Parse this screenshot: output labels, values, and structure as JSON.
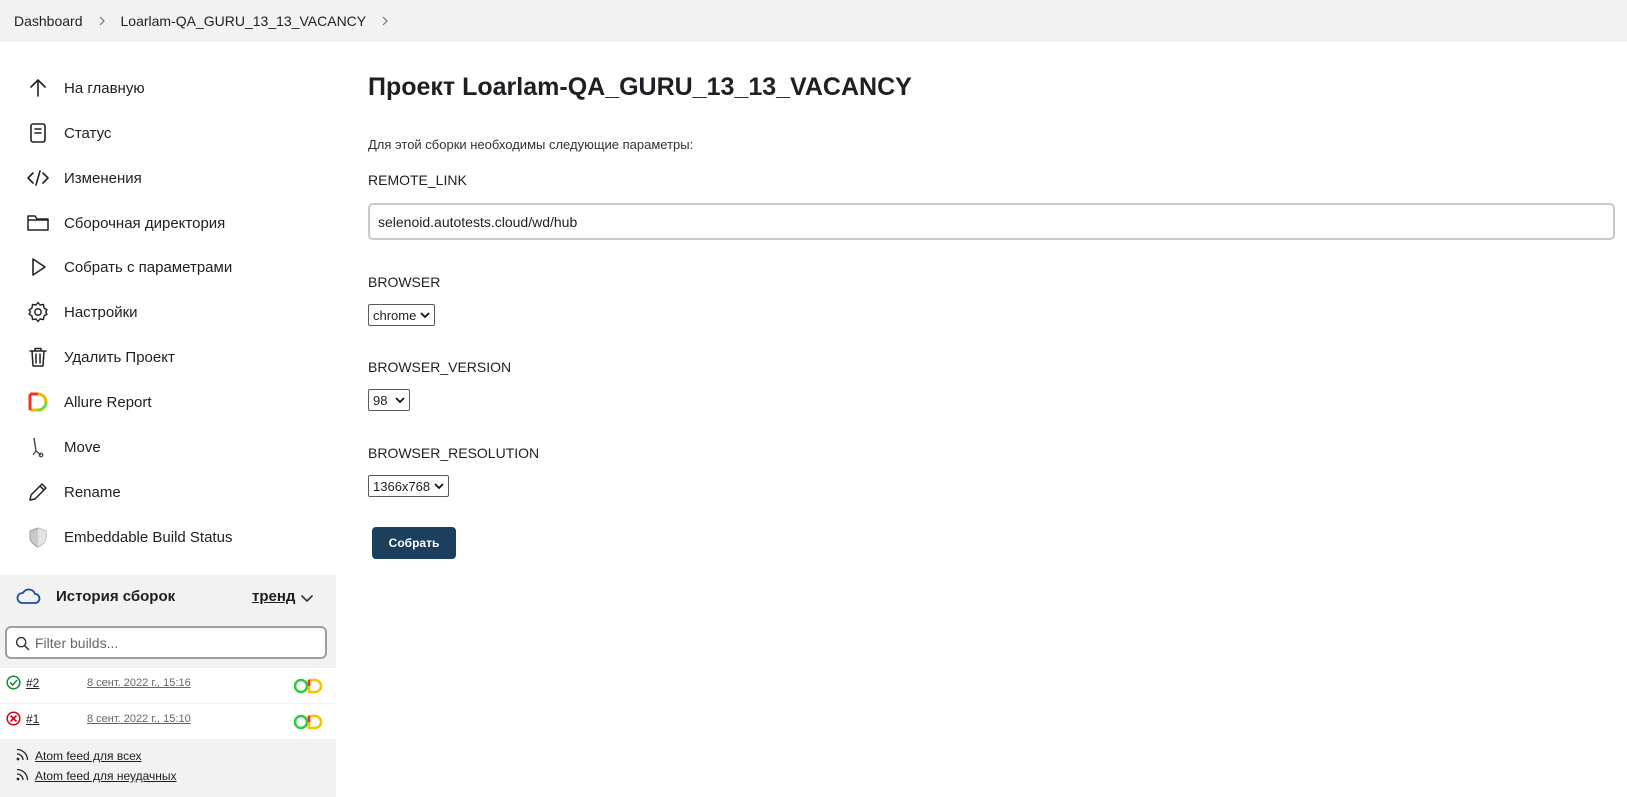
{
  "breadcrumb": {
    "items": [
      "Dashboard",
      "Loarlam-QA_GURU_13_13_VACANCY"
    ]
  },
  "sidebar": {
    "items": [
      {
        "label": "На главную",
        "icon": "arrow-up-icon"
      },
      {
        "label": "Статус",
        "icon": "document-icon"
      },
      {
        "label": "Изменения",
        "icon": "code-icon"
      },
      {
        "label": "Сборочная директория",
        "icon": "folder-icon"
      },
      {
        "label": "Собрать с параметрами",
        "icon": "play-icon"
      },
      {
        "label": "Настройки",
        "icon": "gear-icon"
      },
      {
        "label": "Удалить Проект",
        "icon": "trash-icon"
      },
      {
        "label": "Allure Report",
        "icon": "allure-icon"
      },
      {
        "label": "Move",
        "icon": "move-icon"
      },
      {
        "label": "Rename",
        "icon": "pencil-icon"
      },
      {
        "label": "Embeddable Build Status",
        "icon": "shield-icon"
      }
    ]
  },
  "build_history": {
    "title": "История сборок",
    "trend_label": "тренд",
    "filter_placeholder": "Filter builds...",
    "builds": [
      {
        "number": "#2",
        "date": "8 сент. 2022 г., 15:16",
        "status": "success"
      },
      {
        "number": "#1",
        "date": "8 сент. 2022 г., 15:10",
        "status": "failed"
      }
    ],
    "feeds": [
      "Atom feed для всех",
      "Atom feed для неудачных"
    ]
  },
  "main": {
    "title": "Проект Loarlam-QA_GURU_13_13_VACANCY",
    "description": "Для этой сборки необходимы следующие параметры:",
    "params": {
      "remote_link": {
        "label": "REMOTE_LINK",
        "value": "selenoid.autotests.cloud/wd/hub"
      },
      "browser": {
        "label": "BROWSER",
        "value": "chrome"
      },
      "browser_version": {
        "label": "BROWSER_VERSION",
        "value": "98"
      },
      "browser_resolution": {
        "label": "BROWSER_RESOLUTION",
        "value": "1366x768"
      }
    },
    "build_button": "Собрать"
  },
  "colors": {
    "accent": "#1c3f5e",
    "success": "#138a36",
    "failure": "#d0021b",
    "panel_bg": "#f2f2f2"
  }
}
